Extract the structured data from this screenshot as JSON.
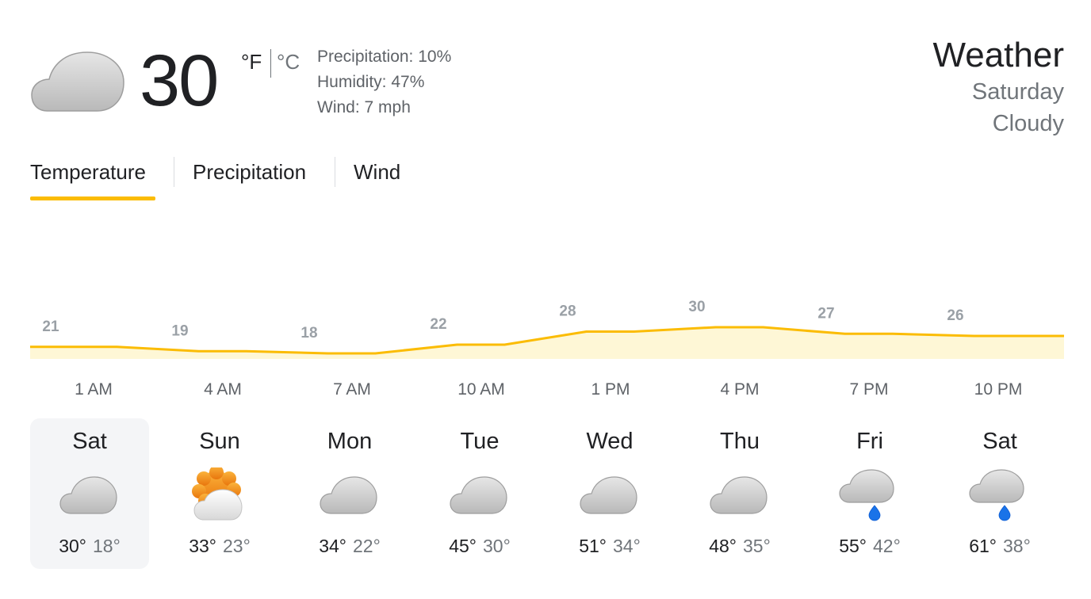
{
  "current": {
    "temp": "30",
    "unit_f": "°F",
    "unit_c": "°C",
    "icon": "cloudy-icon",
    "precipitation": "Precipitation: 10%",
    "humidity": "Humidity: 47%",
    "wind": "Wind: 7 mph"
  },
  "header": {
    "title": "Weather",
    "day": "Saturday",
    "condition": "Cloudy"
  },
  "tabs": [
    {
      "label": "Temperature",
      "selected": true
    },
    {
      "label": "Precipitation",
      "selected": false
    },
    {
      "label": "Wind",
      "selected": false
    }
  ],
  "accent_color": "#fbbc04",
  "chart_data": {
    "type": "area",
    "categories": [
      "1 AM",
      "4 AM",
      "7 AM",
      "10 AM",
      "1 PM",
      "4 PM",
      "7 PM",
      "10 PM"
    ],
    "values": [
      21,
      19,
      18,
      22,
      28,
      30,
      27,
      26
    ],
    "data_labels": [
      "21",
      "19",
      "18",
      "22",
      "28",
      "30",
      "27",
      "26"
    ],
    "title": "",
    "xlabel": "",
    "ylabel": "",
    "grid": false,
    "colors": {
      "line": "#fbbc04",
      "fill": "#fef7d6",
      "labels": "#9aa0a6"
    }
  },
  "forecast": [
    {
      "day": "Sat",
      "icon": "cloudy-icon",
      "hi": "30°",
      "lo": "18°",
      "selected": true
    },
    {
      "day": "Sun",
      "icon": "partly-sunny-icon",
      "hi": "33°",
      "lo": "23°",
      "selected": false
    },
    {
      "day": "Mon",
      "icon": "cloudy-icon",
      "hi": "34°",
      "lo": "22°",
      "selected": false
    },
    {
      "day": "Tue",
      "icon": "cloudy-icon",
      "hi": "45°",
      "lo": "30°",
      "selected": false
    },
    {
      "day": "Wed",
      "icon": "cloudy-icon",
      "hi": "51°",
      "lo": "34°",
      "selected": false
    },
    {
      "day": "Thu",
      "icon": "cloudy-icon",
      "hi": "48°",
      "lo": "35°",
      "selected": false
    },
    {
      "day": "Fri",
      "icon": "rain-icon",
      "hi": "55°",
      "lo": "42°",
      "selected": false
    },
    {
      "day": "Sat",
      "icon": "rain-icon",
      "hi": "61°",
      "lo": "38°",
      "selected": false
    }
  ]
}
